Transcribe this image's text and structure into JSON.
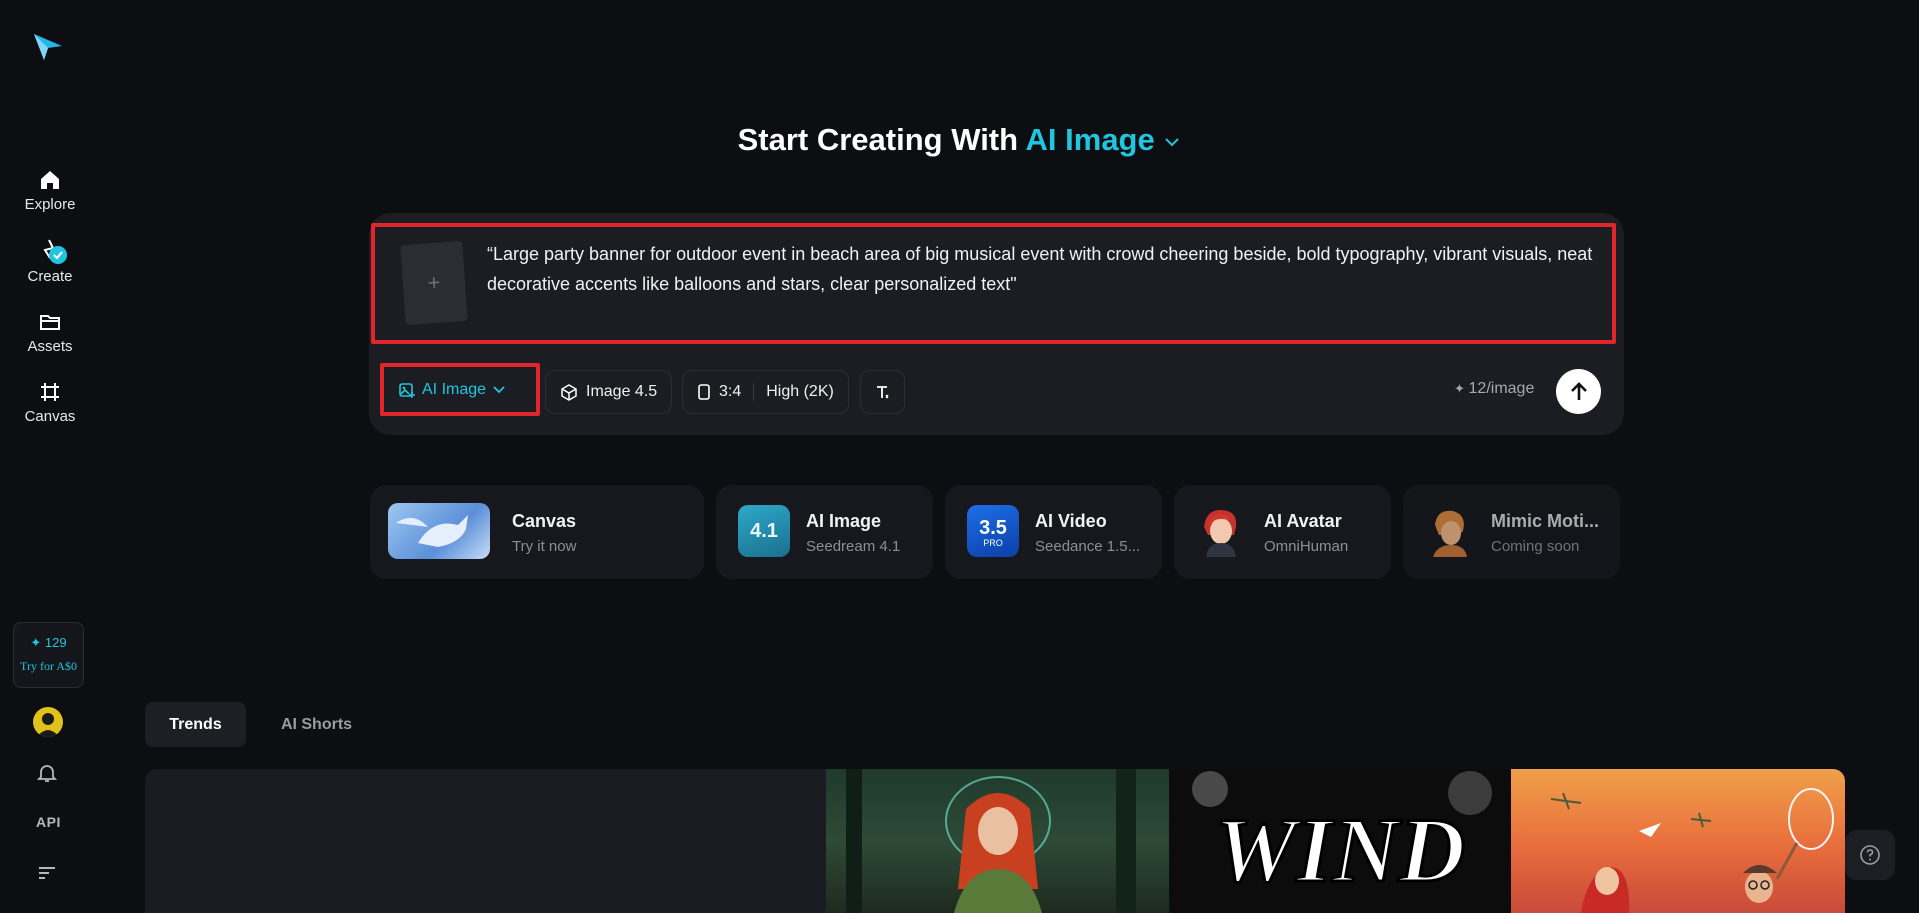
{
  "sidebar": {
    "nav": [
      {
        "label": "Explore",
        "icon": "home-icon"
      },
      {
        "label": "Create",
        "icon": "create-icon"
      },
      {
        "label": "Assets",
        "icon": "folder-icon"
      },
      {
        "label": "Canvas",
        "icon": "canvas-icon"
      }
    ],
    "credits": "✦ 129",
    "try_label": "Try for A$0",
    "api_label": "API"
  },
  "header": {
    "title_prefix": "Start Creating With",
    "title_accent": "AI Image"
  },
  "composer": {
    "prompt": "“Large party banner for  outdoor event in beach area of big musical event with crowd cheering beside, bold typography, vibrant visuals, neat decorative accents like balloons and stars, clear personalized text\"",
    "upload_symbol": "+",
    "mode_label": "AI Image",
    "model_label": "Image 4.5",
    "ratio_label": "3:4",
    "quality_label": "High (2K)",
    "cost_label": "12/image"
  },
  "cards": [
    {
      "title": "Canvas",
      "subtitle": "Try it now"
    },
    {
      "title": "AI Image",
      "subtitle": "Seedream 4.1",
      "badge": "4.1"
    },
    {
      "title": "AI Video",
      "subtitle": "Seedance 1.5...",
      "badge": "3.5",
      "badge_sub": "PRO"
    },
    {
      "title": "AI Avatar",
      "subtitle": "OmniHuman"
    },
    {
      "title": "Mimic Moti...",
      "subtitle": "Coming soon"
    }
  ],
  "tabs": [
    {
      "label": "Trends",
      "active": true
    },
    {
      "label": "AI Shorts",
      "active": false
    }
  ],
  "gallery": {
    "wind_text": "WIND"
  },
  "colors": {
    "accent": "#20c5e0",
    "highlight_border": "#e0252b",
    "background": "#0d0e11"
  }
}
